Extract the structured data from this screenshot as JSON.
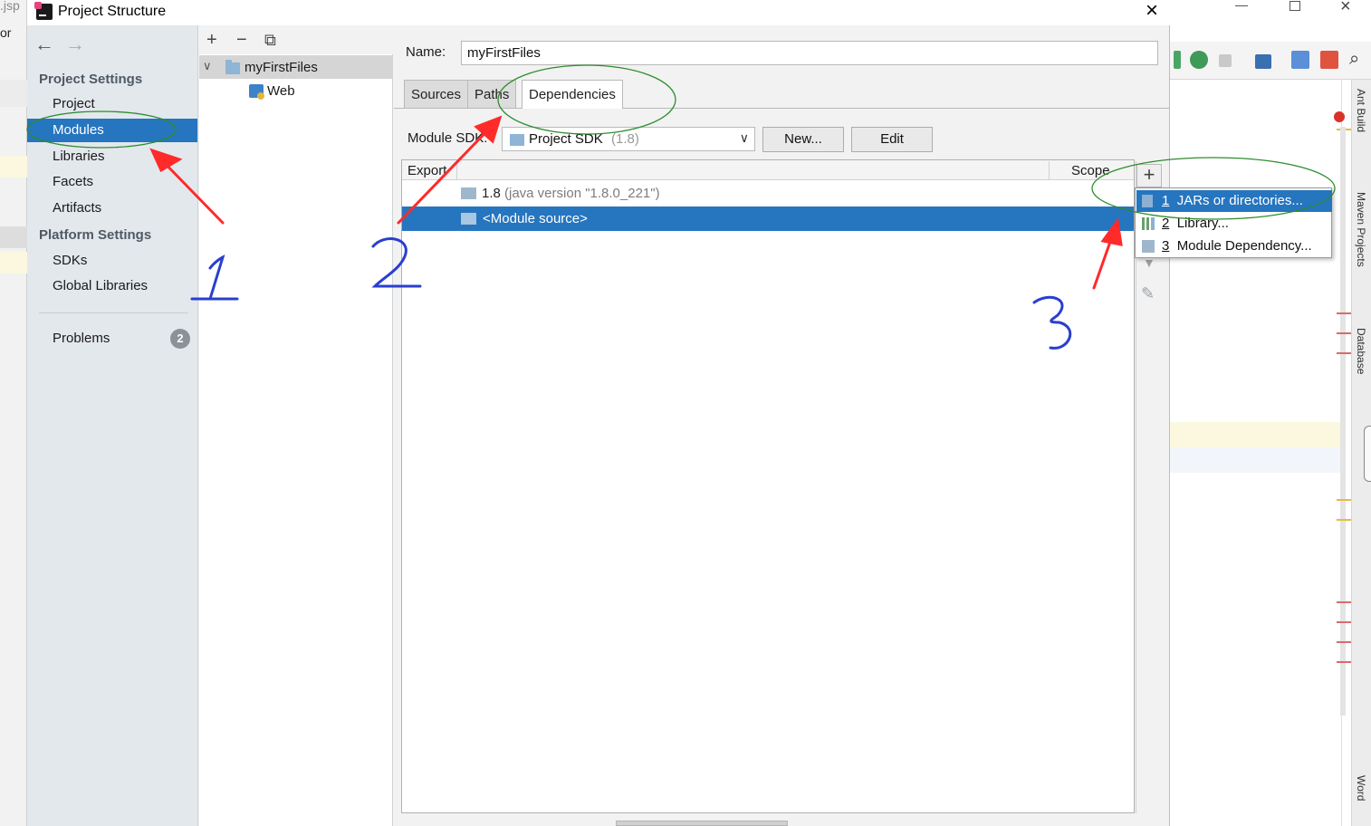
{
  "background": {
    "left_tab_text": ".jsp",
    "left_text_2": "or",
    "tool_windows": [
      "Ant Build",
      "Maven Projects",
      "Database",
      "Word"
    ]
  },
  "dialog": {
    "title": "Project Structure",
    "close_glyph": "×"
  },
  "nav": {
    "back_glyph": "←",
    "forward_glyph": "→",
    "project_settings_header": "Project Settings",
    "project_settings_items": [
      "Project",
      "Modules",
      "Libraries",
      "Facets",
      "Artifacts"
    ],
    "platform_settings_header": "Platform Settings",
    "platform_settings_items": [
      "SDKs",
      "Global Libraries"
    ],
    "problems_label": "Problems",
    "problems_count": "2",
    "selected_item": "Modules"
  },
  "tree": {
    "add_glyph": "+",
    "remove_glyph": "−",
    "copy_glyph": "⧉",
    "module_name": "myFirstFiles",
    "facet_name": "Web"
  },
  "module": {
    "name_label": "Name:",
    "name_value": "myFirstFiles",
    "tabs": [
      "Sources",
      "Paths",
      "Dependencies"
    ],
    "active_tab": "Dependencies",
    "sdk_label": "Module SDK:",
    "sdk_value": "Project SDK",
    "sdk_version": "(1.8)",
    "new_button": "New...",
    "edit_button": "Edit"
  },
  "dependencies": {
    "columns": [
      "Export",
      "Scope"
    ],
    "rows": [
      {
        "name": "1.8",
        "detail": "(java version \"1.8.0_221\")",
        "selected": false
      },
      {
        "name": "<Module source>",
        "detail": "",
        "selected": true
      }
    ]
  },
  "add_menu": {
    "items": [
      {
        "num": "1",
        "label": "JARs or directories..."
      },
      {
        "num": "2",
        "label": "Library..."
      },
      {
        "num": "3",
        "label": "Module Dependency..."
      }
    ],
    "highlighted_index": 0
  },
  "annotations": {
    "step_labels": [
      "1",
      "2",
      "3"
    ]
  },
  "colors": {
    "selection": "#2675bf",
    "annotation_arrow": "#ff2a2a",
    "annotation_ellipse": "#2e8b2e",
    "annotation_ink": "#2a3fcf"
  }
}
